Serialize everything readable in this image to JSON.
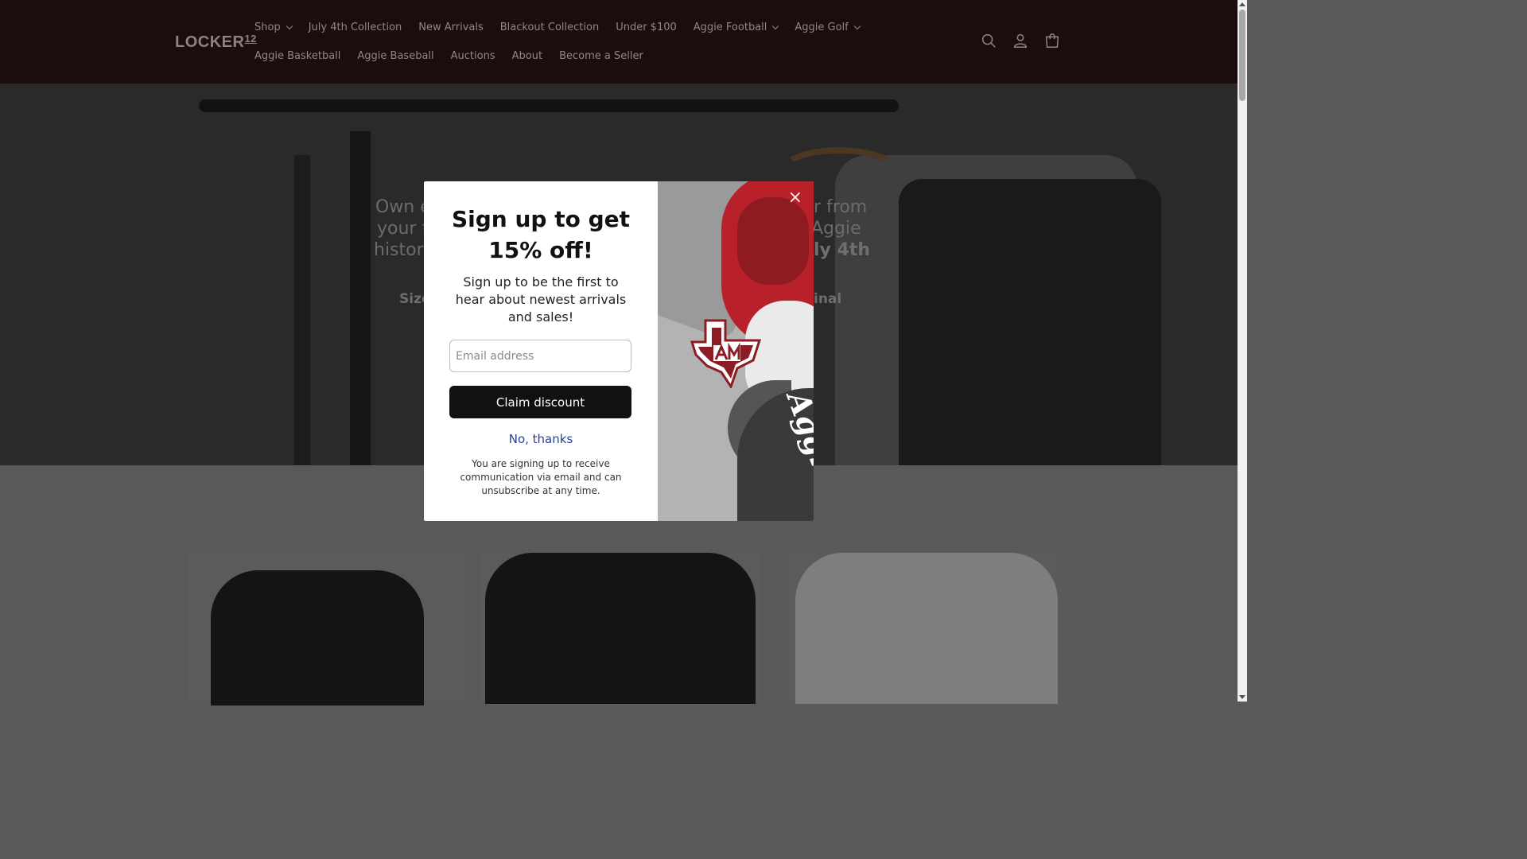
{
  "header": {
    "logo_text": "LOCKER",
    "logo_sup": "12",
    "nav_row1": [
      {
        "label": "Shop",
        "dropdown": true
      },
      {
        "label": "July 4th Collection",
        "dropdown": false
      },
      {
        "label": "New Arrivals",
        "dropdown": false
      },
      {
        "label": "Blackout Collection",
        "dropdown": false
      },
      {
        "label": "Under $100",
        "dropdown": false
      },
      {
        "label": "Aggie Football",
        "dropdown": true
      },
      {
        "label": "Aggie Golf",
        "dropdown": true
      }
    ],
    "nav_row2": [
      {
        "label": "Aggie Basketball"
      },
      {
        "label": "Aggie Baseball"
      },
      {
        "label": "Auctions"
      },
      {
        "label": "About"
      },
      {
        "label": "Become a Seller"
      }
    ],
    "icons": [
      "search-icon",
      "account-icon",
      "cart-icon"
    ]
  },
  "hero": {
    "left_lines": [
      "Own e",
      "your f",
      "histor"
    ],
    "right_lines": [
      "r from",
      "Aggie",
      "ly 4th"
    ],
    "left_sub": "Size",
    "right_sub": "inal"
  },
  "popup": {
    "title": "Sign up to get 15% off!",
    "subtitle": "Sign up to be the first to hear about newest arrivals and sales!",
    "email_placeholder": "Email address",
    "email_value": "",
    "claim_label": "Claim discount",
    "decline_label": "No, thanks",
    "legal": "You are signing up to receive communication via email and can unsubscribe at any time.",
    "close_label": "×"
  },
  "colors": {
    "header_bg": "#1c0c0d",
    "button_bg": "#111111",
    "link": "#2a3f9a",
    "maroon": "#500000"
  }
}
